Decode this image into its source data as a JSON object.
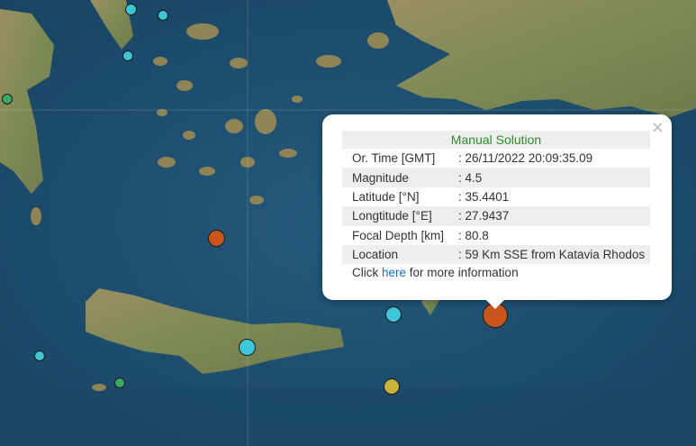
{
  "popup": {
    "title": "Manual Solution",
    "close_glyph": "×",
    "rows": [
      {
        "label": "Or. Time [GMT]",
        "value": ": 26/11/2022 20:09:35.09"
      },
      {
        "label": "Magnitude",
        "value": ": 4.5"
      },
      {
        "label": "Latitude [°N]",
        "value": ": 35.4401"
      },
      {
        "label": "Longtitude [°E]",
        "value": ": 27.9437"
      },
      {
        "label": "Focal Depth [km]",
        "value": ": 80.8"
      },
      {
        "label": "Location",
        "value": ": 59 Km SSE from Katavia Rhodos"
      }
    ],
    "more_prefix": "Click ",
    "more_link": "here",
    "more_suffix": " for more information"
  },
  "colors": {
    "sea": "#1d4a68",
    "land": "#8a8258",
    "marker_cyan": "#3ec6d6",
    "marker_orange": "#c8561c",
    "marker_green": "#3aa86a",
    "marker_yellow": "#c9b23e"
  }
}
